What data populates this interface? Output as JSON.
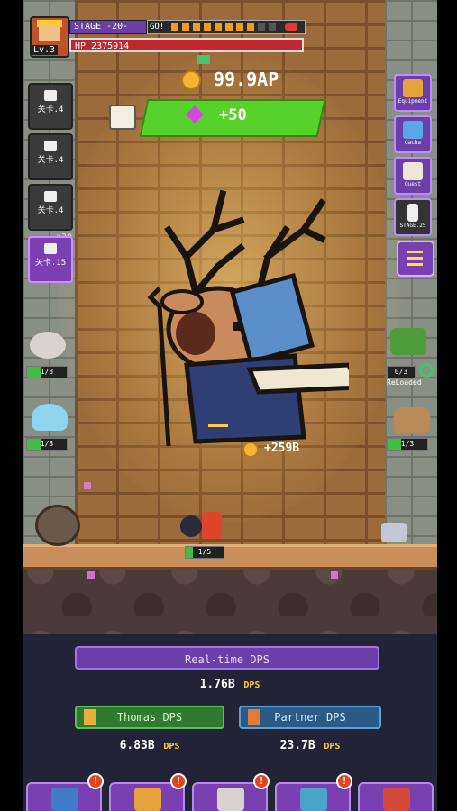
{
  "hud": {
    "level": "Lv.3",
    "stage": "STAGE -20-",
    "go_label": "GO!",
    "hp": "HP 2375914",
    "currency": "99.9AP",
    "gem_reward": "+50"
  },
  "left_column": {
    "locks": [
      "关卡.4",
      "关卡.4",
      "关卡.4"
    ],
    "active": {
      "label": "关卡.15",
      "multiplier": "x30"
    }
  },
  "right_column": [
    {
      "label": "Equipment",
      "icon": "helmet-icon"
    },
    {
      "label": "Gacha",
      "icon": "gacha-icon"
    },
    {
      "label": "Quest",
      "icon": "quest-scroll-icon"
    },
    {
      "label": "STAGE.25",
      "icon": "lock-icon"
    }
  ],
  "units_left": [
    {
      "count": "1/3",
      "fill": 0.33
    },
    {
      "count": "1/3",
      "fill": 0.33
    }
  ],
  "units_right": [
    {
      "count": "0/3",
      "fill": 0.0,
      "status": "ReLoaded"
    },
    {
      "count": "1/3",
      "fill": 0.33
    }
  ],
  "battle": {
    "coin_drop": "+259B",
    "hero_count": "1/5",
    "hero_fill": 0.2
  },
  "stats": {
    "realtime_label": "Real-time DPS",
    "realtime_value": "1.76B",
    "unit": "DPS",
    "thomas_label": "Thomas DPS",
    "thomas_value": "6.83B",
    "partner_label": "Partner DPS",
    "partner_value": "23.7B"
  },
  "tabs": [
    {
      "icon": "hero-icon",
      "alert": "!"
    },
    {
      "icon": "upgrade-hammer-icon",
      "alert": "!"
    },
    {
      "icon": "skill-scroll-icon",
      "alert": "!"
    },
    {
      "icon": "arcade-machine-icon",
      "alert": "!"
    },
    {
      "icon": "shop-icon",
      "alert": ""
    }
  ],
  "colors": {
    "accent_purple": "#7a3fb0",
    "gem_green": "#57d12b",
    "hp_red": "#c1272d",
    "coin_gold": "#f2b632"
  }
}
